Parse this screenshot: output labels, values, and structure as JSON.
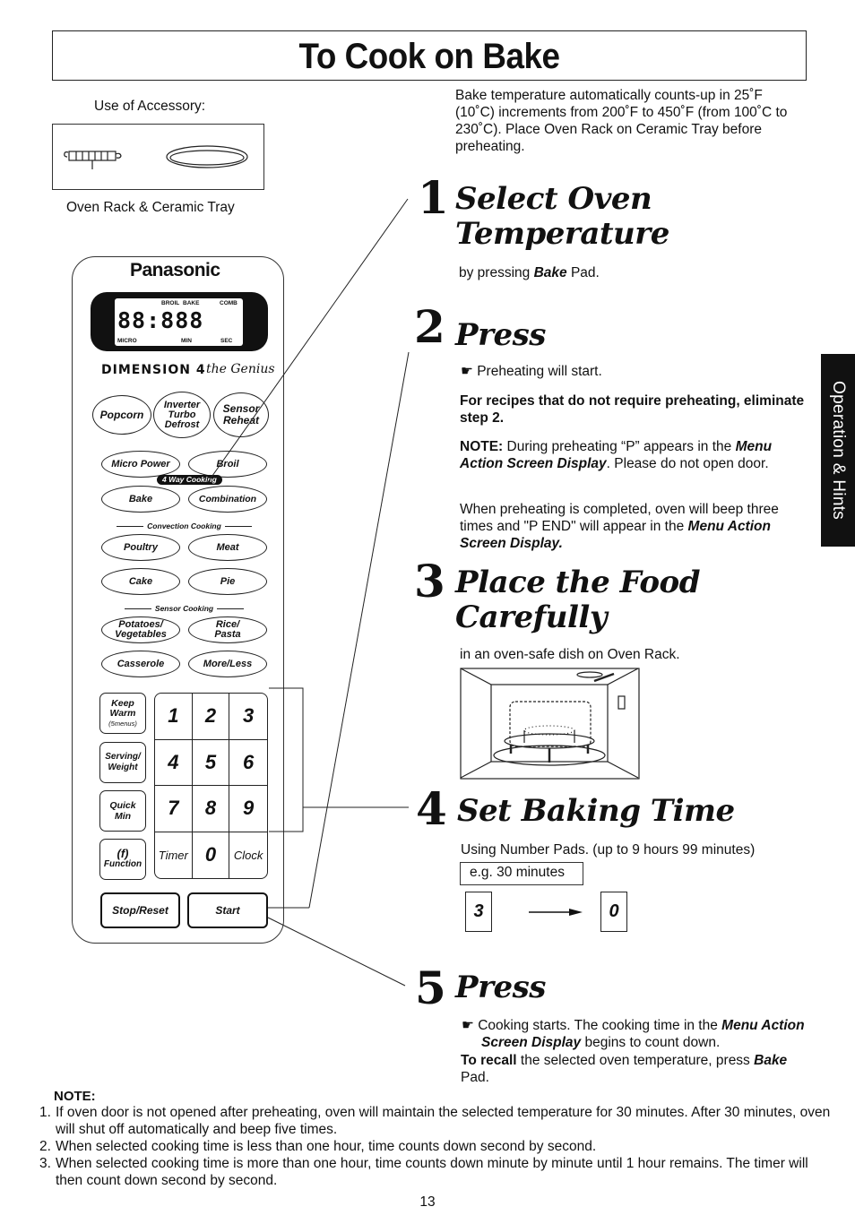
{
  "title": "To Cook on Bake",
  "accessory": {
    "label": "Use of Accessory:",
    "caption": "Oven Rack & Ceramic Tray"
  },
  "intro": "Bake temperature automatically counts-up in 25˚F (10˚C) increments from 200˚F to 450˚F (from 100˚C to 230˚C). Place Oven Rack on Ceramic Tray before preheating.",
  "side_tab": "Operation & Hints",
  "steps": [
    {
      "number": "1",
      "heading_line1": "Select Oven",
      "heading_line2": "Temperature",
      "body_pre": "by pressing ",
      "body_em": "Bake",
      "body_post": " Pad."
    },
    {
      "number": "2",
      "heading": "Press",
      "bullet": "Preheating will start.",
      "bold_note": "For recipes that do not require preheating, eliminate step 2.",
      "note_label": "NOTE:",
      "note_pre": " During preheating “P” appears in the ",
      "note_em": "Menu Action Screen Display",
      "note_post": ". Please do not open door.",
      "complete_pre": "When preheating is completed, oven will beep three times and \"P END\" will appear in the ",
      "complete_em": "Menu Action Screen Display."
    },
    {
      "number": "3",
      "heading_line1": "Place the Food",
      "heading_line2": "Carefully",
      "body": "in an oven-safe dish on Oven Rack."
    },
    {
      "number": "4",
      "heading": "Set Baking Time",
      "body": "Using Number Pads. (up to 9 hours 99 minutes)",
      "example_label": "e.g. 30 minutes",
      "example_keys": [
        "3",
        "0"
      ]
    },
    {
      "number": "5",
      "heading": "Press",
      "bullet_pre": "Cooking starts. The cooking time in the ",
      "bullet_em": "Menu Action Screen Display",
      "bullet_post": " begins to count down.",
      "recall_bold": "To recall",
      "recall_pre": " the selected oven temperature, press ",
      "recall_em": "Bake",
      "recall_post": " Pad."
    }
  ],
  "panel": {
    "brand": "Panasonic",
    "lcd": {
      "digits": "88:888",
      "labels": {
        "broil": "BROIL",
        "bake": "BAKE",
        "comb": "COMB",
        "micro": "MICRO",
        "min": "MIN",
        "sec": "SEC"
      }
    },
    "logo": "DIMENSION 4",
    "logo_script": "the Genius",
    "buttons": {
      "popcorn": "Popcorn",
      "inverter": [
        "Inverter",
        "Turbo",
        "Defrost"
      ],
      "sensor_reheat": [
        "Sensor",
        "Reheat"
      ],
      "micro_power": "Micro Power",
      "broil": "Broil",
      "four_way": "4 Way Cooking",
      "bake": "Bake",
      "combination": "Combination",
      "convection_label": "Convection Cooking",
      "poultry": "Poultry",
      "meat": "Meat",
      "cake": "Cake",
      "pie": "Pie",
      "sensor_label": "Sensor Cooking",
      "potatoes": [
        "Potatoes/",
        "Vegetables"
      ],
      "rice": [
        "Rice/",
        "Pasta"
      ],
      "casserole": "Casserole",
      "more_less": "More/Less",
      "keep_warm": [
        "Keep",
        "Warm",
        "(5menus)"
      ],
      "serving": [
        "Serving/",
        "Weight"
      ],
      "quick_min": [
        "Quick",
        "Min"
      ],
      "function": [
        "(f)",
        "Function"
      ],
      "stop_reset": "Stop/Reset",
      "start": "Start"
    },
    "keypad": [
      "1",
      "2",
      "3",
      "4",
      "5",
      "6",
      "7",
      "8",
      "9",
      "Timer",
      "0",
      "Clock"
    ]
  },
  "note": {
    "title": "NOTE:",
    "items": [
      {
        "n": "1.",
        "text": "If oven door is not opened after preheating, oven will maintain the selected temperature for 30 minutes. After 30 minutes, oven will shut off automatically and beep five times."
      },
      {
        "n": "2.",
        "text": "When selected cooking time is less than one hour, time counts down second by second."
      },
      {
        "n": "3.",
        "text": "When selected cooking time is more than one hour, time counts down minute by minute until 1 hour remains. The timer will then count down second by second."
      }
    ]
  },
  "page_number": "13"
}
